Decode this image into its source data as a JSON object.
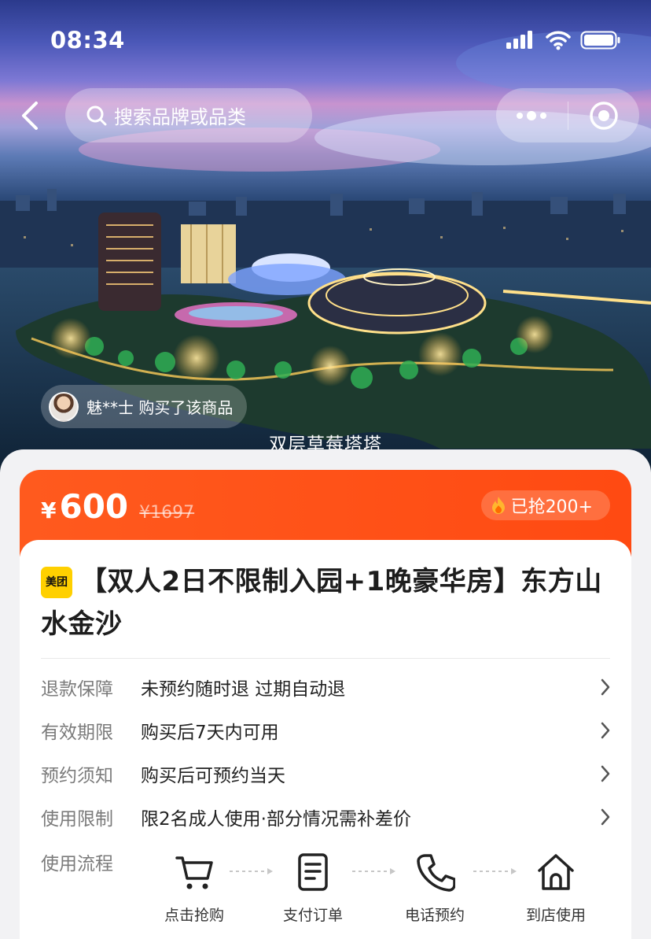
{
  "status_bar": {
    "time": "08:34"
  },
  "header": {
    "back_icon": "chevron-left-icon",
    "search": {
      "placeholder": "搜索品牌或品类",
      "icon": "search-icon"
    },
    "capsule": {
      "more_icon": "more-dots-icon",
      "close_icon": "target-icon"
    }
  },
  "hero": {
    "buyer_notice": "魅**士 购买了该商品",
    "caption": "双层草莓塔塔"
  },
  "price": {
    "currency": "¥",
    "current": "600",
    "original": "¥1697",
    "sold_icon": "flame-icon",
    "sold_text": "已抢200+"
  },
  "product": {
    "brand_logo": "美团",
    "title": "【双人2日不限制入园+1晚豪华房】东方山水金沙"
  },
  "info_rows": [
    {
      "key": "退款保障",
      "value": "未预约随时退 过期自动退"
    },
    {
      "key": "有效期限",
      "value": "购买后7天内可用"
    },
    {
      "key": "预约须知",
      "value": "购买后可预约当天"
    },
    {
      "key": "使用限制",
      "value": "限2名成人使用·部分情况需补差价"
    }
  ],
  "usage_flow": {
    "label": "使用流程",
    "steps": [
      {
        "icon": "cart-icon",
        "label": "点击抢购"
      },
      {
        "icon": "receipt-icon",
        "label": "支付订单"
      },
      {
        "icon": "phone-icon",
        "label": "电话预约"
      },
      {
        "icon": "store-icon",
        "label": "到店使用"
      }
    ]
  },
  "colors": {
    "accent": "#ff4a12",
    "brand_yellow": "#ffd000"
  }
}
